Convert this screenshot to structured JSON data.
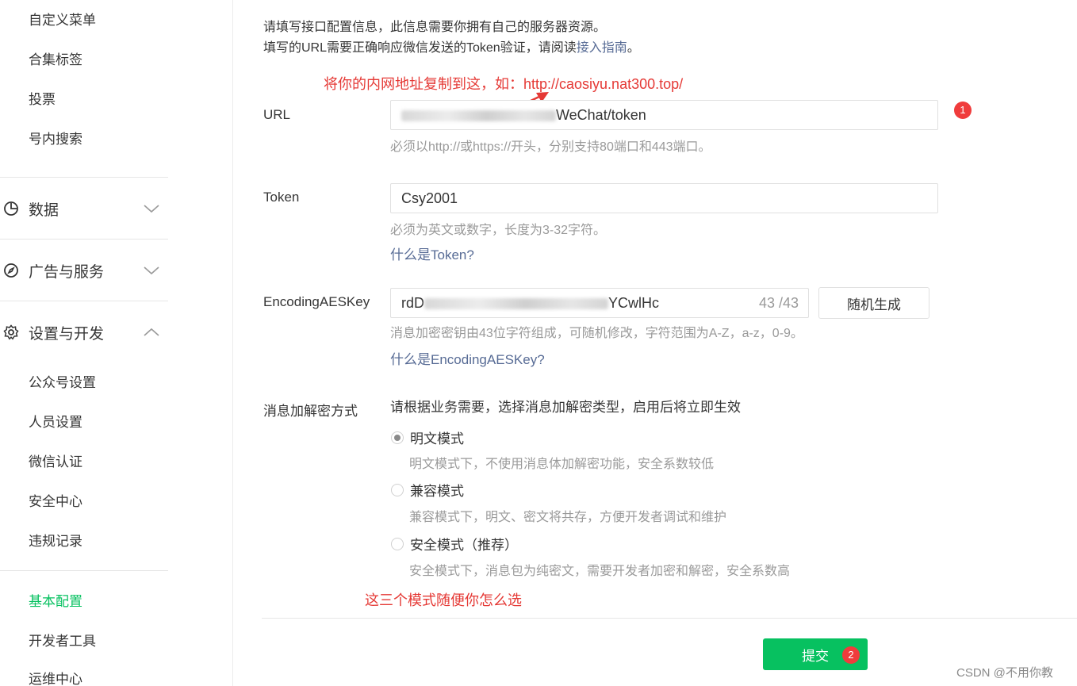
{
  "sidebar": {
    "sub_items_top": [
      "自定义菜单",
      "合集标签",
      "投票",
      "号内搜索"
    ],
    "groups": {
      "data": "数据",
      "ads": "广告与服务",
      "settings": "设置与开发"
    },
    "settings_items": [
      "公众号设置",
      "人员设置",
      "微信认证",
      "安全中心",
      "违规记录"
    ],
    "dev_items": [
      "基本配置",
      "开发者工具",
      "运维中心"
    ],
    "active_item": "基本配置"
  },
  "intro": {
    "line1": "请填写接口配置信息，此信息需要你拥有自己的服务器资源。",
    "line2_prefix": "填写的URL需要正确响应微信发送的Token验证，请阅读",
    "line2_link": "接入指南",
    "line2_suffix": "。"
  },
  "url_field": {
    "label": "URL",
    "value_visible": "WeChat/token",
    "hint": "必须以http://或https://开头，分别支持80端口和443端口。"
  },
  "token_field": {
    "label": "Token",
    "value": "Csy2001",
    "hint": "必须为英文或数字，长度为3-32字符。",
    "link": "什么是Token?"
  },
  "aes_field": {
    "label": "EncodingAESKey",
    "value_start": "rdD",
    "value_end": "YCwlHc",
    "count": "43 /43",
    "random_button": "随机生成",
    "hint": "消息加密密钥由43位字符组成，可随机修改，字符范围为A-Z，a-z，0-9。",
    "link": "什么是EncodingAESKey?"
  },
  "encrypt_mode": {
    "label": "消息加解密方式",
    "instruction": "请根据业务需要，选择消息加解密类型，启用后将立即生效",
    "options": [
      {
        "label": "明文模式",
        "desc": "明文模式下，不使用消息体加解密功能，安全系数较低",
        "checked": true
      },
      {
        "label": "兼容模式",
        "desc": "兼容模式下，明文、密文将共存，方便开发者调试和维护",
        "checked": false
      },
      {
        "label": "安全模式（推荐）",
        "desc": "安全模式下，消息包为纯密文，需要开发者加密和解密，安全系数高",
        "checked": false
      }
    ]
  },
  "annotations": {
    "url_tip": "将你的内网地址复制到这，如：http://caosiyu.nat300.top/",
    "mode_tip": "这三个模式随便你怎么选",
    "badge1": "1",
    "badge2": "2"
  },
  "submit_button": "提交",
  "watermark": "CSDN @不用你教",
  "colors": {
    "accent_green": "#07c160",
    "link_blue": "#576b95",
    "annotation_red": "#e53935",
    "hint_gray": "#9a9a9a"
  }
}
